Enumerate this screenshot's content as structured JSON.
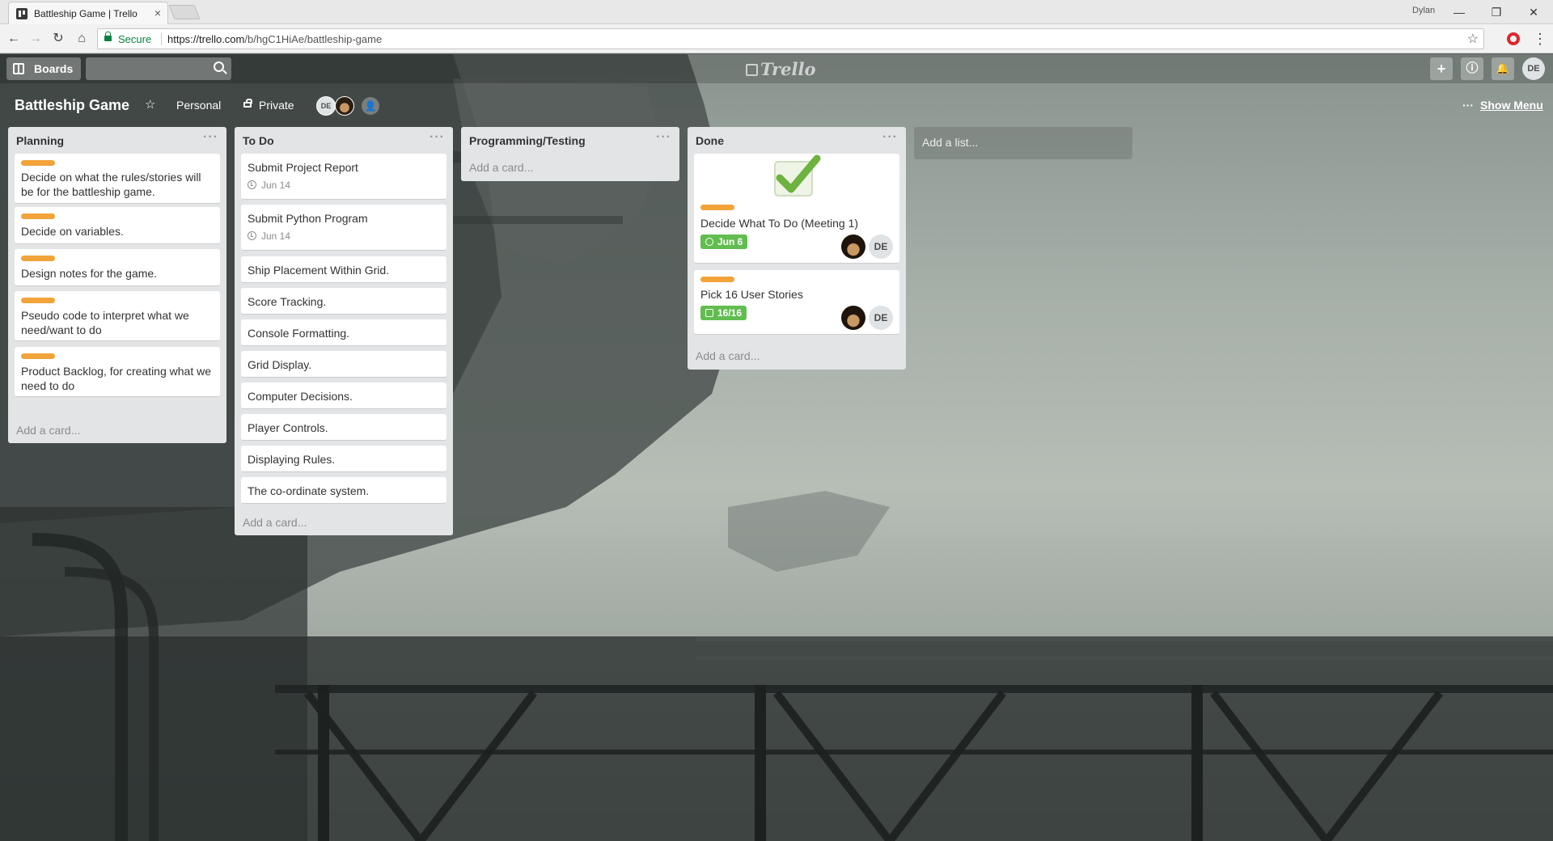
{
  "browser": {
    "tab_title": "Battleship Game | Trello",
    "tab_close": "×",
    "user": "Dylan",
    "window_controls": {
      "minimize": "—",
      "restore": "❐",
      "close": "✕"
    },
    "nav": {
      "back": "←",
      "forward": "→",
      "reload": "↻",
      "home": "⌂"
    },
    "secure_label": "Secure",
    "url_host": "https://trello.com",
    "url_path": "/b/hgC1HiAe/battleship-game",
    "bookmark_star": "☆",
    "menu_glyph": "⋮",
    "icons": [
      "trello-favicon",
      "lock-icon",
      "star-icon",
      "opera-icon"
    ]
  },
  "header": {
    "boards_label": "Boards",
    "search_value": "",
    "logo_text": "Trello",
    "add_button": "+",
    "info_button": "ⓘ",
    "notifications_button": "🔔",
    "avatar_initials": "DE"
  },
  "board": {
    "title": "Battleship Game",
    "star": "☆",
    "team": "Personal",
    "visibility": "Private",
    "members": [
      {
        "initials": "DE"
      },
      {
        "initials": ""
      }
    ],
    "add_member": "👤",
    "show_menu_dots": "···",
    "show_menu": "Show Menu",
    "add_list": "Add a list..."
  },
  "lists": [
    {
      "title": "Planning",
      "menu": "···",
      "add_card": "Add a card...",
      "cards": [
        {
          "text": "Decide on what the rules/stories will be for the battleship game.",
          "label_color": "#f2a33a"
        },
        {
          "text": "Decide on variables.",
          "label_color": "#f2a33a"
        },
        {
          "text": "Design notes for the game.",
          "label_color": "#f2a33a"
        },
        {
          "text": "Pseudo code to interpret what we need/want to do",
          "label_color": "#f2a33a"
        },
        {
          "text": "Product Backlog, for creating what we need to do",
          "label_color": "#f2a33a"
        }
      ]
    },
    {
      "title": "To Do",
      "menu": "···",
      "add_card": "Add a card...",
      "cards": [
        {
          "text": "Submit Project Report",
          "due": "Jun 14"
        },
        {
          "text": "Submit Python Program",
          "due": "Jun 14"
        },
        {
          "text": "Ship Placement Within Grid."
        },
        {
          "text": "Score Tracking."
        },
        {
          "text": "Console Formatting."
        },
        {
          "text": "Grid Display."
        },
        {
          "text": "Computer Decisions."
        },
        {
          "text": "Player Controls."
        },
        {
          "text": "Displaying Rules."
        },
        {
          "text": "The co-ordinate system."
        }
      ]
    },
    {
      "title": "Programming/Testing",
      "menu": "···",
      "add_card": "Add a card...",
      "cards": []
    },
    {
      "title": "Done",
      "menu": "···",
      "add_card": "Add a card...",
      "cards": [
        {
          "text": "Decide What To Do (Meeting 1)",
          "label_color": "#f2a33a",
          "cover": "green-checkmark",
          "due_complete": "Jun 6",
          "members": [
            "",
            "DE"
          ]
        },
        {
          "text": "Pick 16 User Stories",
          "label_color": "#f2a33a",
          "checklist": "16/16",
          "members": [
            "",
            "DE"
          ]
        }
      ]
    }
  ],
  "colors": {
    "label_orange": "#f2a33a",
    "badge_green": "#61bd4f",
    "list_bg": "#e2e4e6",
    "secure_green": "#0b8043"
  }
}
